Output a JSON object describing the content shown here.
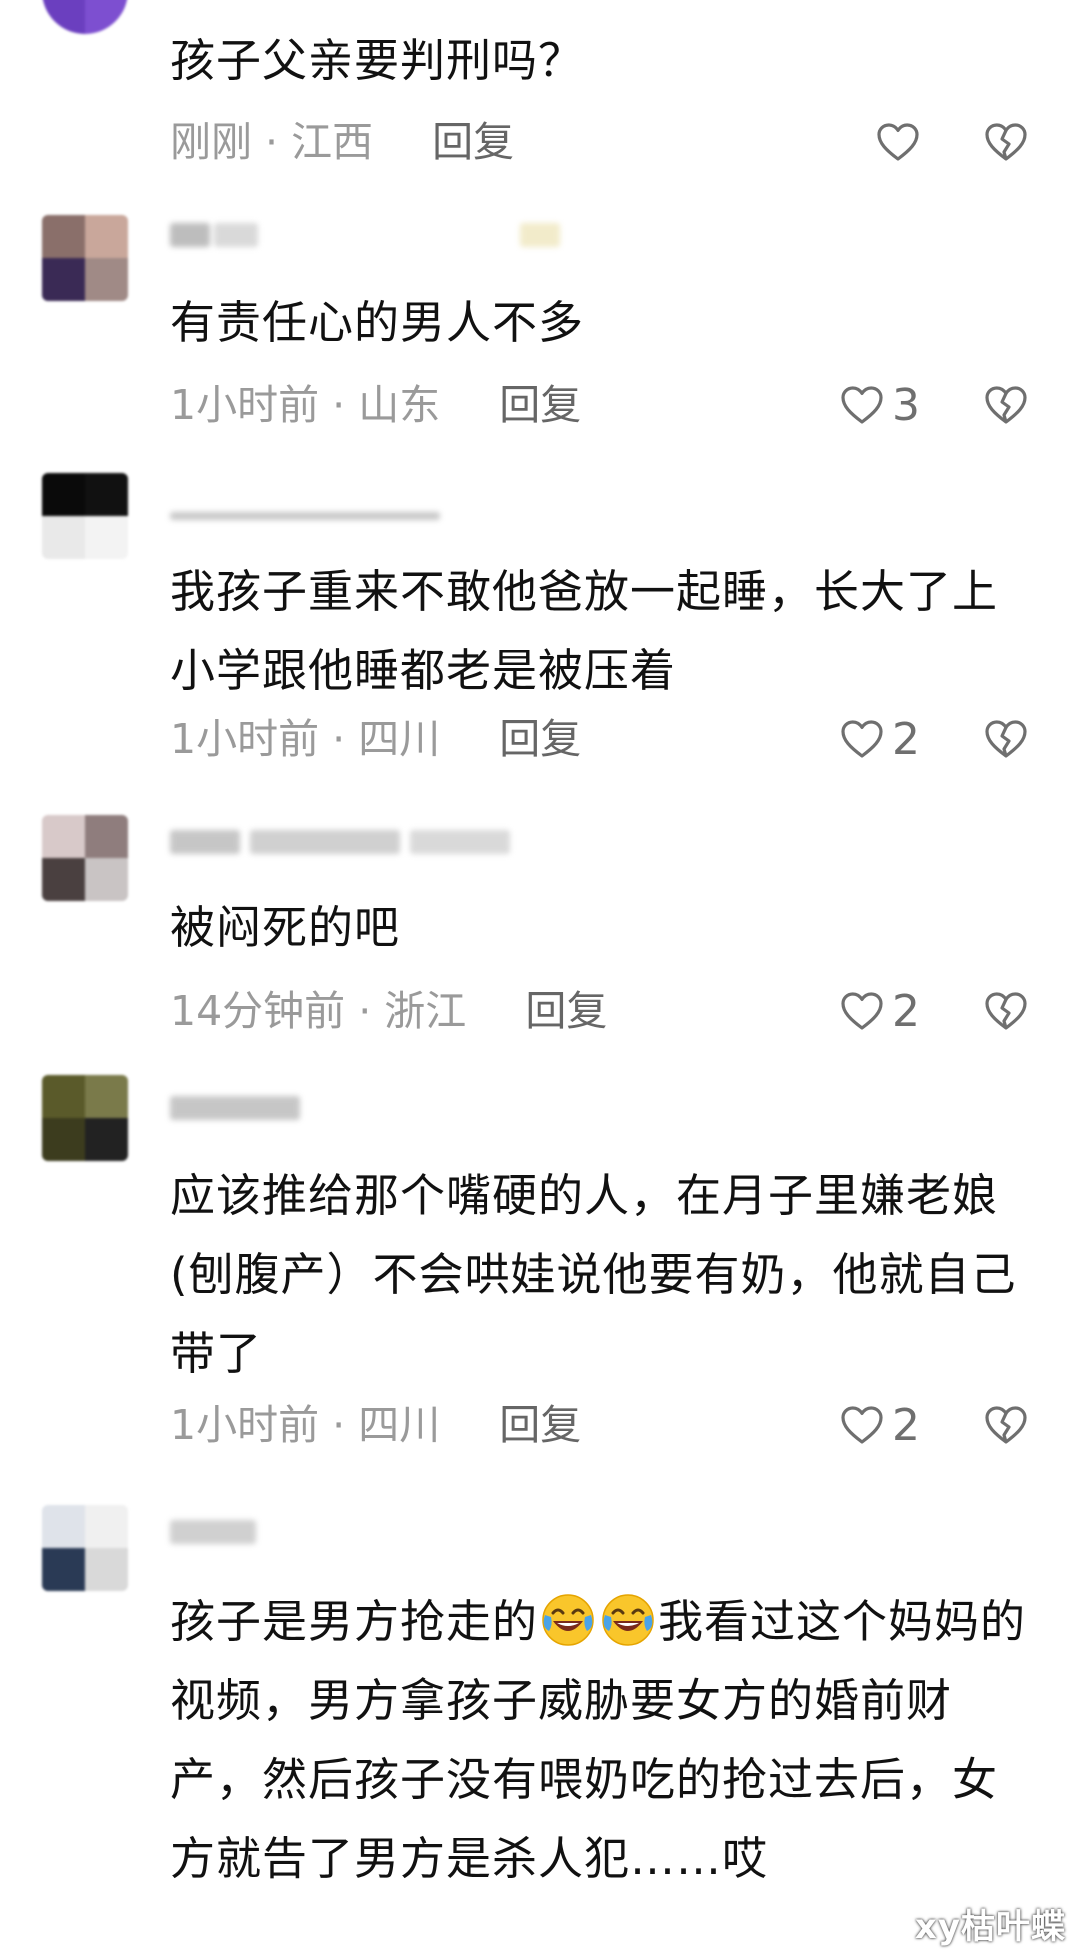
{
  "comments": [
    {
      "text": "孩子父亲要判刑吗？",
      "time": "刚刚",
      "location": "江西",
      "reply": "回复",
      "likes": "",
      "avatar_colors": [
        "#6b3fbf",
        "#7d4fd0",
        "#6b3fbf",
        "#7d4fd0"
      ]
    },
    {
      "text": "有责任心的男人不多",
      "time": "1小时前",
      "location": "山东",
      "reply": "回复",
      "likes": "3",
      "avatar_colors": [
        "#8a6f6a",
        "#c9a79b",
        "#3a2a55",
        "#a08a86"
      ]
    },
    {
      "text": "我孩子重来不敢他爸放一起睡，长大了上小学跟他睡都老是被压着",
      "time": "1小时前",
      "location": "四川",
      "reply": "回复",
      "likes": "2",
      "avatar_colors": [
        "#0a0a0a",
        "#111111",
        "#e9e9e9",
        "#f3f3f3"
      ]
    },
    {
      "text": "被闷死的吧",
      "time": "14分钟前",
      "location": "浙江",
      "reply": "回复",
      "likes": "2",
      "avatar_colors": [
        "#d8c9c9",
        "#8f7d7d",
        "#4a4040",
        "#c9c4c4"
      ]
    },
    {
      "text": "应该推给那个嘴硬的人，在月子里嫌老娘(刨腹产）不会哄娃说他要有奶，他就自己带了",
      "time": "1小时前",
      "location": "四川",
      "reply": "回复",
      "likes": "2",
      "avatar_colors": [
        "#5a5a2a",
        "#7a7a4a",
        "#3c3c1e",
        "#222222"
      ]
    },
    {
      "text_parts": [
        "孩子是男方抢走的",
        "我看过这个妈妈的视频，男方拿孩子威胁要女方的婚前财产，然后孩子没有喂奶吃的抢过去后，女方就告了男方是杀人犯……哎"
      ],
      "emoji_icons": [
        "laughing-crying-emoji",
        "laughing-crying-emoji"
      ],
      "avatar_colors": [
        "#dfe3ea",
        "#f0f0f0",
        "#2a3a55",
        "#d9d9d9"
      ]
    }
  ],
  "watermark": "xy枯叶蝶",
  "colors": {
    "heart_stroke": "#6f6f6f",
    "meta": "#9a9a9a",
    "text": "#111111"
  }
}
